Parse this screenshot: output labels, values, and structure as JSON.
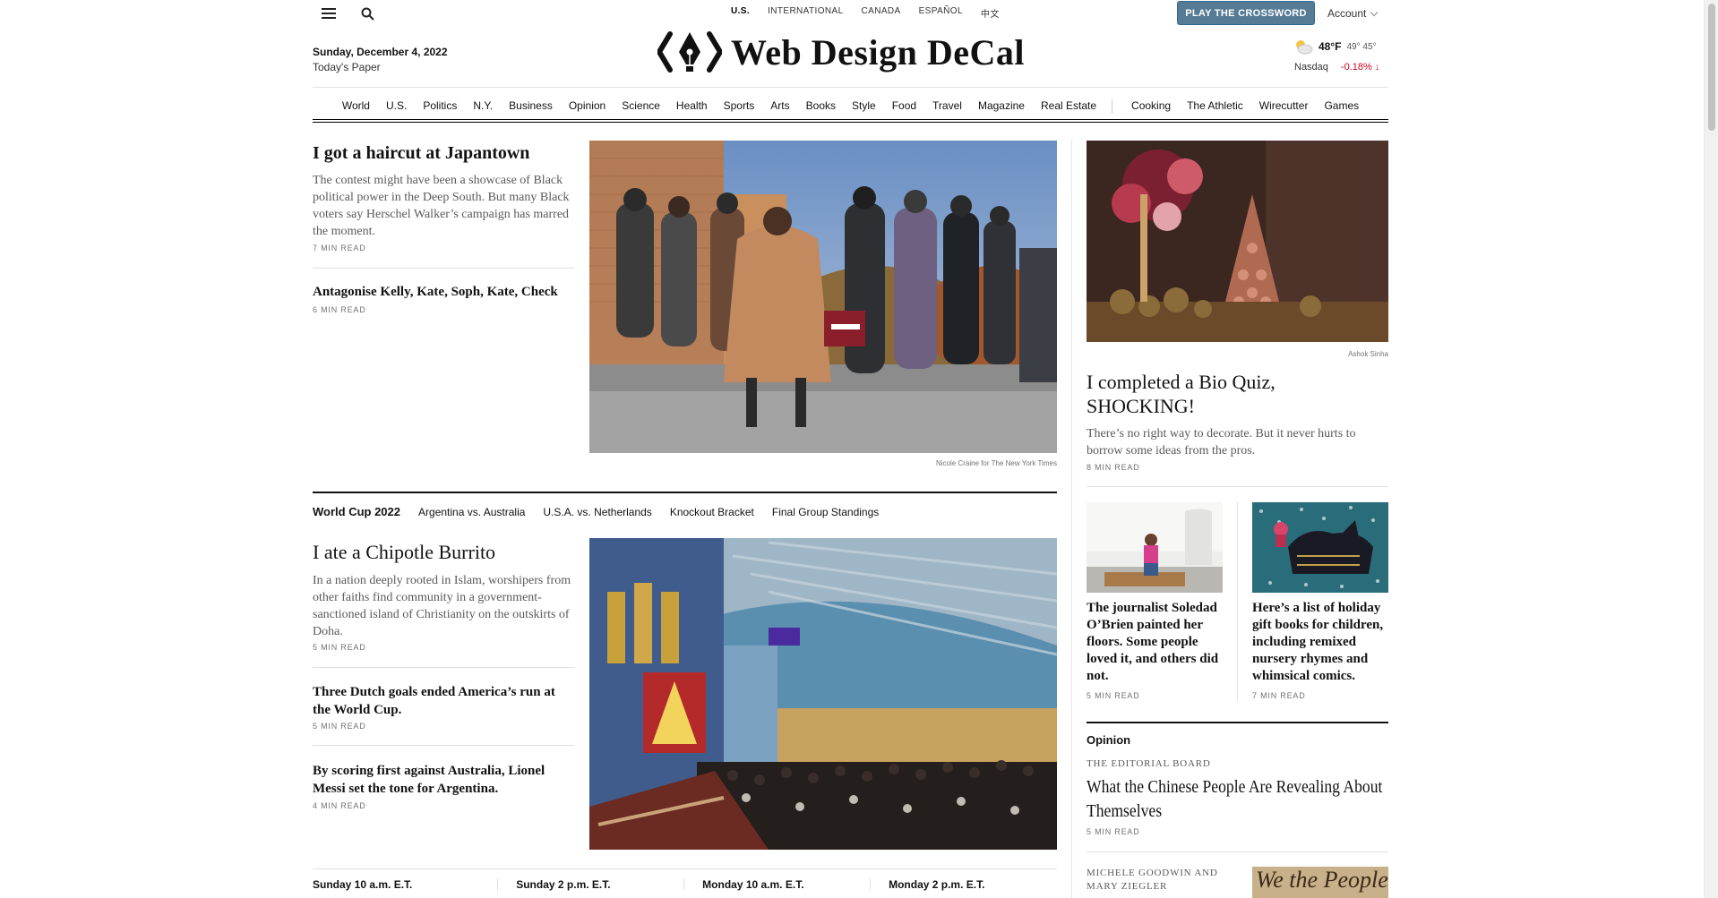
{
  "header": {
    "editions": [
      "U.S.",
      "INTERNATIONAL",
      "CANADA",
      "ESPAÑOL",
      "中文"
    ],
    "crossword_label": "PLAY THE CROSSWORD",
    "account_label": "Account",
    "date": "Sunday, December 4, 2022",
    "todays_paper": "Today's Paper",
    "logo_text": "Web Design DeCal",
    "weather": {
      "temp": "48°F",
      "range": "49° 45°"
    },
    "market": {
      "name": "Nasdaq",
      "change": "-0.18%"
    }
  },
  "nav": {
    "primary": [
      "World",
      "U.S.",
      "Politics",
      "N.Y.",
      "Business",
      "Opinion",
      "Science",
      "Health",
      "Sports",
      "Arts",
      "Books",
      "Style",
      "Food",
      "Travel",
      "Magazine",
      "Real Estate"
    ],
    "secondary": [
      "Cooking",
      "The Athletic",
      "Wirecutter",
      "Games"
    ]
  },
  "lead": {
    "headline": "I got a haircut at Japantown",
    "summary": "The contest might have been a showcase of Black political power in the Deep South. But many Black voters say Herschel Walker’s campaign has marred the moment.",
    "readtime": "7 MIN READ",
    "second_headline": "Antagonise Kelly, Kate, Soph, Kate, Check",
    "second_readtime": "6 MIN READ",
    "photo_credit": "Nicole Craine for The New York Times"
  },
  "worldcup": {
    "label": "World Cup 2022",
    "links": [
      "Argentina vs. Australia",
      "U.S.A. vs. Netherlands",
      "Knockout Bracket",
      "Final Group Standings"
    ],
    "headline": "I ate a Chipotle Burrito",
    "summary": "In a nation deeply rooted in Islam, worshipers from other faiths find community in a government-sanctioned island of Christianity on the outskirts of Doha.",
    "readtime": "5 MIN READ",
    "story2_headline": "Three Dutch goals ended America’s run at the World Cup.",
    "story2_readtime": "5 MIN READ",
    "story3_headline": "By scoring first against Australia, Lionel Messi set the tone for Argentina.",
    "story3_readtime": "4 MIN READ"
  },
  "schedule": [
    "Sunday 10 a.m. E.T.",
    "Sunday 2 p.m. E.T.",
    "Monday 10 a.m. E.T.",
    "Monday 2 p.m. E.T."
  ],
  "right": {
    "photo_credit": "Ashok Sinha",
    "headline": "I completed a Bio Quiz, SHOCKING!",
    "summary": "There’s no right way to decorate. But it never hurts to borrow some ideas from the pros.",
    "readtime": "8 MIN READ",
    "card1_headline": "The journalist Soledad O’Brien painted her floors. Some people loved it, and others did not.",
    "card1_readtime": "5 MIN READ",
    "card2_headline": "Here’s a list of holiday gift books for children, including remixed nursery rhymes and whimsical comics.",
    "card2_readtime": "7 MIN READ",
    "opinion_label": "Opinion",
    "opinion_kicker": "THE EDITORIAL BOARD",
    "opinion_headline": "What the Chinese People Are Revealing About Themselves",
    "opinion_readtime": "5 MIN READ",
    "opinion2_kicker": "MICHELE GOODWIN AND MARY ZIEGLER",
    "opinion2_image_text": "We the People"
  },
  "colors": {
    "crossword_bg": "#567b95",
    "change_red": "#d0021b"
  }
}
